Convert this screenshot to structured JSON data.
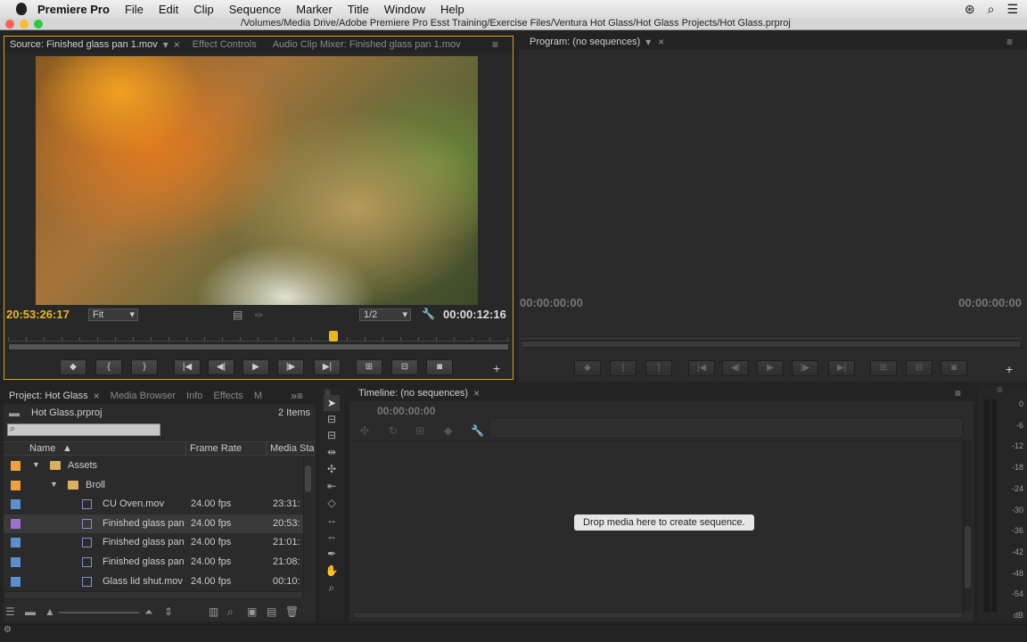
{
  "menubar": {
    "app": "Premiere Pro",
    "items": [
      "File",
      "Edit",
      "Clip",
      "Sequence",
      "Marker",
      "Title",
      "Window",
      "Help"
    ]
  },
  "window": {
    "path": "/Volumes/Media Drive/Adobe Premiere Pro Esst Training/Exercise Files/Ventura Hot Glass/Hot Glass Projects/Hot Glass.prproj"
  },
  "source": {
    "tabs": [
      "Source: Finished glass pan 1.mov",
      "Effect Controls",
      "Audio Clip Mixer: Finished glass pan 1.mov"
    ],
    "timecode_left": "20:53:26:17",
    "zoom": "Fit",
    "resolution": "1/2",
    "timecode_right": "00:00:12:16",
    "playhead_fraction": 0.65
  },
  "program": {
    "tab": "Program: (no sequences)",
    "timecode_left": "00:00:00:00",
    "timecode_right": "00:00:00:00"
  },
  "project": {
    "tabs": [
      "Project: Hot Glass",
      "Media Browser",
      "Info",
      "Effects",
      "M"
    ],
    "file": "Hot Glass.prproj",
    "items_count": "2 Items",
    "columns": [
      "Name",
      "Frame Rate",
      "Media Sta"
    ],
    "rows": [
      {
        "name": "Assets",
        "type": "folder",
        "color": "#f0a040",
        "rate": "",
        "start": ""
      },
      {
        "name": "Broll",
        "type": "folder",
        "color": "#f0a040",
        "rate": "",
        "start": ""
      },
      {
        "name": "CU Oven.mov",
        "type": "clip",
        "color": "#5a8fd0",
        "rate": "24.00 fps",
        "start": "23:31:"
      },
      {
        "name": "Finished glass pan",
        "type": "clip",
        "color": "#a070d0",
        "rate": "24.00 fps",
        "start": "20:53:"
      },
      {
        "name": "Finished glass pan",
        "type": "clip",
        "color": "#5a8fd0",
        "rate": "24.00 fps",
        "start": "21:01:"
      },
      {
        "name": "Finished glass pan",
        "type": "clip",
        "color": "#5a8fd0",
        "rate": "24.00 fps",
        "start": "21:08:"
      },
      {
        "name": "Glass lid shut.mov",
        "type": "clip",
        "color": "#5a8fd0",
        "rate": "24.00 fps",
        "start": "00:10:"
      }
    ]
  },
  "timeline": {
    "tab": "Timeline: (no sequences)",
    "timecode": "00:00:00:00",
    "drop_hint": "Drop media here to create sequence."
  },
  "meter": {
    "labels": [
      "0",
      "-6",
      "-12",
      "-18",
      "-24",
      "-30",
      "-36",
      "-42",
      "-48",
      "-54",
      "dB"
    ]
  }
}
